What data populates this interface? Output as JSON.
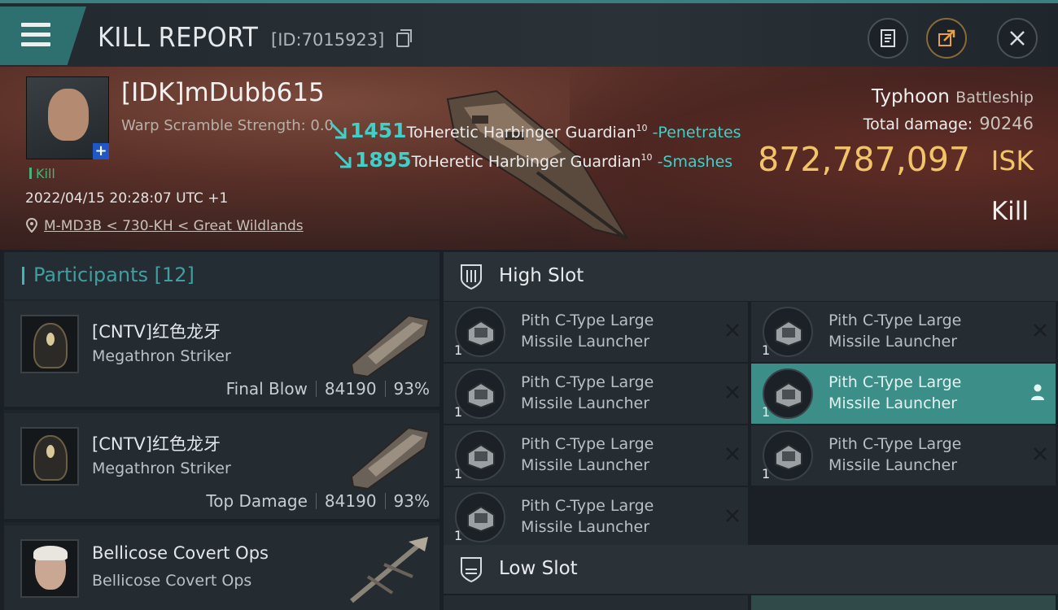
{
  "header": {
    "title": "KILL REPORT",
    "report_id": "[ID:7015923]"
  },
  "victim": {
    "pilot_name": "[IDK]mDubb615",
    "warp_scramble": "Warp Scramble Strength: 0.0",
    "status_tag": "Kill",
    "datetime": "2022/04/15 20:28:07 UTC +1",
    "location": "M-MD3B < 730-KH < Great Wildlands",
    "ship_name": "Typhoon",
    "ship_class": "Battleship",
    "total_damage_label": "Total damage:",
    "total_damage_value": "90246",
    "isk_value": "872,787,097",
    "isk_unit": "ISK",
    "result": "Kill"
  },
  "damage_log": [
    {
      "amount": "1451",
      "target": "ToHeretic Harbinger Guardian",
      "level": "10",
      "verb": "-Penetrates"
    },
    {
      "amount": "1895",
      "target": "ToHeretic Harbinger Guardian",
      "level": "10",
      "verb": "-Smashes"
    }
  ],
  "participants": {
    "label": "Participants",
    "count": "[12]",
    "items": [
      {
        "name": "[CNTV]红色龙牙",
        "ship": "Megathron Striker",
        "tag": "Final Blow",
        "damage": "84190",
        "percent": "93%"
      },
      {
        "name": "[CNTV]红色龙牙",
        "ship": "Megathron Striker",
        "tag": "Top Damage",
        "damage": "84190",
        "percent": "93%"
      },
      {
        "name": "Bellicose Covert Ops",
        "ship": "Bellicose Covert Ops",
        "tag": "",
        "damage": "",
        "percent": ""
      }
    ]
  },
  "fitting": {
    "high_slot_label": "High Slot",
    "low_slot_label": "Low Slot",
    "high_slot": [
      {
        "line1": "Pith C-Type Large",
        "line2": "Missile Launcher",
        "qty": "1"
      },
      {
        "line1": "Pith C-Type Large",
        "line2": "Missile Launcher",
        "qty": "1"
      },
      {
        "line1": "Pith C-Type Large",
        "line2": "Missile Launcher",
        "qty": "1"
      },
      {
        "line1": "Pith C-Type Large",
        "line2": "Missile Launcher",
        "qty": "1"
      },
      {
        "line1": "Pith C-Type Large",
        "line2": "Missile Launcher",
        "qty": "1"
      },
      {
        "line1": "Pith C-Type Large",
        "line2": "Missile Launcher",
        "qty": "1"
      },
      {
        "line1": "Pith C-Type Large",
        "line2": "Missile Launcher",
        "qty": "1"
      }
    ]
  },
  "colors": {
    "accent": "#3c8f88",
    "isk": "#f2c46a",
    "damage": "#3fd0c8",
    "kill_tag": "#48b37a"
  }
}
